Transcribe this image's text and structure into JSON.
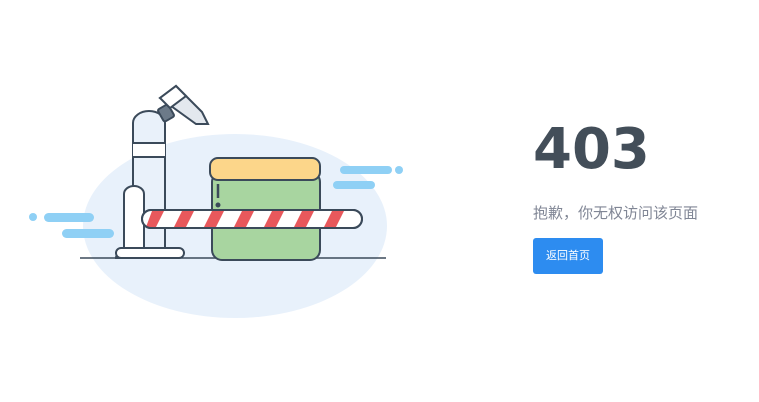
{
  "error": {
    "code": "403",
    "description": "抱歉，你无权访问该页面"
  },
  "actions": {
    "back_home_label": "返回首页"
  },
  "colors": {
    "code_text": "#434e59",
    "desc_text": "#808695",
    "primary_button": "#2d8cf0",
    "bg_ellipse": "#e8f1fb",
    "cloud": "#8fd0f5",
    "box_green": "#a8d5a0",
    "box_lid": "#fcd68a",
    "barrier_red": "#e8585c"
  },
  "icons": {
    "illustration": "security-camera-barrier-illustration"
  }
}
